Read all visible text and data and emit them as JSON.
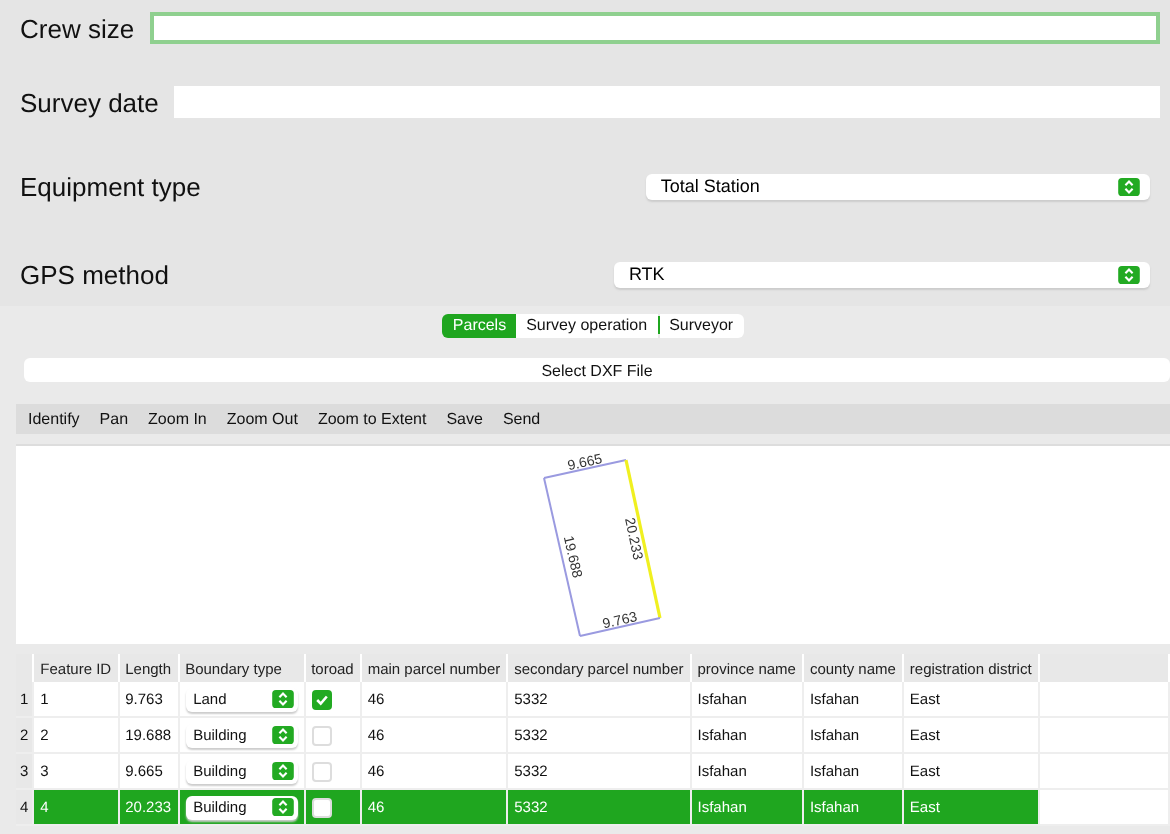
{
  "form": [
    {
      "kind": "text",
      "label": "Crew size",
      "focused": true
    },
    {
      "kind": "text",
      "label": "Survey date",
      "focused": false
    },
    {
      "kind": "select",
      "label": "Equipment type",
      "value": "Total Station"
    },
    {
      "kind": "select",
      "label": "GPS method",
      "value": "RTK"
    }
  ],
  "tabs": [
    {
      "label": "Parcels",
      "selected": true
    },
    {
      "label": "Survey operation",
      "selected": false
    },
    {
      "label": "Surveyor",
      "selected": false
    }
  ],
  "dxf_button": "Select DXF File",
  "toolbar": [
    "Identify",
    "Pan",
    "Zoom In",
    "Zoom Out",
    "Zoom to Extent",
    "Save",
    "Send"
  ],
  "map": {
    "edges": [
      {
        "label": "9.665",
        "highlighted": false
      },
      {
        "label": "20.233",
        "highlighted": true
      },
      {
        "label": "9.763",
        "highlighted": false
      },
      {
        "label": "19.688",
        "highlighted": false
      }
    ]
  },
  "table": {
    "columns": [
      "Feature ID",
      "Length",
      "Boundary type",
      "toroad",
      "main parcel number",
      "secondary parcel number",
      "province name",
      "county name",
      "registration district"
    ],
    "rows": [
      {
        "index": "1",
        "cells": [
          "1",
          "9.763",
          "Land",
          "",
          "46",
          "5332",
          "Isfahan",
          "Isfahan",
          "East"
        ],
        "toroad": true,
        "selected": false
      },
      {
        "index": "2",
        "cells": [
          "2",
          "19.688",
          "Building",
          "",
          "46",
          "5332",
          "Isfahan",
          "Isfahan",
          "East"
        ],
        "toroad": false,
        "selected": false
      },
      {
        "index": "3",
        "cells": [
          "3",
          "9.665",
          "Building",
          "",
          "46",
          "5332",
          "Isfahan",
          "Isfahan",
          "East"
        ],
        "toroad": false,
        "selected": false
      },
      {
        "index": "4",
        "cells": [
          "4",
          "20.233",
          "Building",
          "",
          "46",
          "5332",
          "Isfahan",
          "Isfahan",
          "East"
        ],
        "toroad": false,
        "selected": true
      }
    ]
  }
}
